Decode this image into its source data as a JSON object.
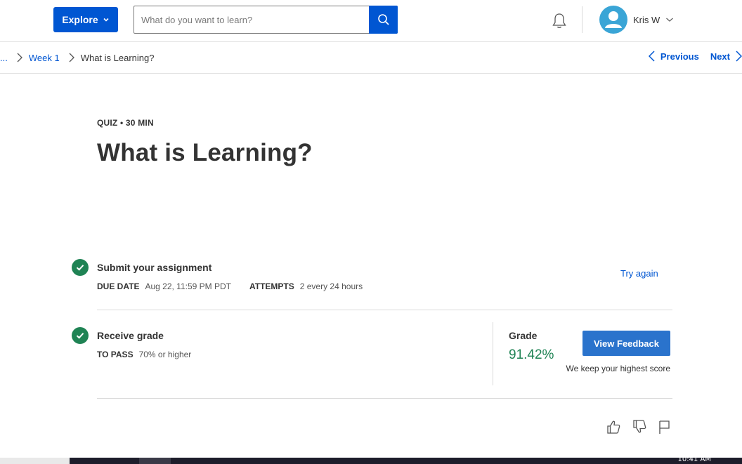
{
  "header": {
    "explore_label": "Explore",
    "search_placeholder": "What do you want to learn?",
    "user_name": "Kris W"
  },
  "breadcrumb": {
    "ellipsis": "...",
    "items": [
      {
        "label": "Week 1"
      },
      {
        "label": "What is Learning?"
      }
    ]
  },
  "navigation": {
    "previous_label": "Previous",
    "next_label": "Next"
  },
  "quiz": {
    "eyebrow": "QUIZ • 30 MIN",
    "title": "What is Learning?"
  },
  "submit": {
    "title": "Submit your assignment",
    "due_label": "DUE DATE",
    "due_value": "Aug 22, 11:59 PM PDT",
    "attempts_label": "ATTEMPTS",
    "attempts_value": "2 every 24 hours",
    "try_again_label": "Try again"
  },
  "grade": {
    "title": "Receive grade",
    "pass_label": "TO PASS",
    "pass_value": "70% or higher",
    "grade_label": "Grade",
    "grade_value": "91.42%",
    "feedback_button": "View Feedback",
    "note": "We keep your highest score"
  },
  "taskbar": {
    "clock": "10:41 AM"
  },
  "colors": {
    "brand_blue": "#0056d2",
    "success_green": "#1f8354",
    "button_blue": "#2a73cc",
    "avatar_blue": "#3aa5d6"
  },
  "icons": [
    "chevron-down-icon",
    "search-icon",
    "bell-icon",
    "user-avatar-icon",
    "chevron-right-icon",
    "chevron-left-icon",
    "check-icon",
    "thumbs-up-icon",
    "thumbs-down-icon",
    "flag-icon"
  ]
}
